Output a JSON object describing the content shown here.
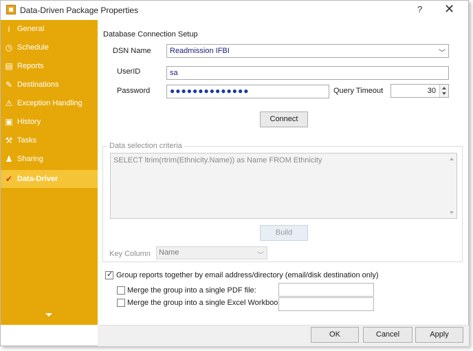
{
  "window": {
    "title": "Data-Driven Package Properties",
    "help": "?",
    "close": "✕"
  },
  "sidebar": {
    "items": [
      {
        "label": "General",
        "icon": "info-icon",
        "glyph": "i"
      },
      {
        "label": "Schedule",
        "icon": "clock-icon",
        "glyph": "◷"
      },
      {
        "label": "Reports",
        "icon": "report-icon",
        "glyph": "▤"
      },
      {
        "label": "Destinations",
        "icon": "destination-icon",
        "glyph": "✎"
      },
      {
        "label": "Exception Handling",
        "icon": "warning-icon",
        "glyph": "⚠"
      },
      {
        "label": "History",
        "icon": "history-icon",
        "glyph": "▣"
      },
      {
        "label": "Tasks",
        "icon": "tasks-icon",
        "glyph": "⚒"
      },
      {
        "label": "Sharing",
        "icon": "sharing-icon",
        "glyph": "♟"
      },
      {
        "label": "Data-Driver",
        "icon": "data-driver-icon",
        "glyph": "✔"
      }
    ],
    "active": "Data-Driver",
    "background": "#e6a808",
    "active_background": "#f6c437"
  },
  "connection": {
    "heading": "Database Connection Setup",
    "dsn_label": "DSN Name",
    "dsn_value": "Readmission IFBI",
    "userid_label": "UserID",
    "userid_value": "sa",
    "password_label": "Password",
    "password_value": "●●●●●●●●●●●●●●",
    "timeout_label": "Query Timeout",
    "timeout_value": "30",
    "connect_label": "Connect"
  },
  "criteria": {
    "title": "Data selection criteria",
    "sql": "SELECT ltrim(rtrim(Ethnicity.Name)) as Name FROM Ethnicity",
    "build_label": "Build",
    "key_column_label": "Key Column",
    "key_column_value": "Name"
  },
  "grouping": {
    "group_label": "Group reports together by email address/directory (email/disk destination only)",
    "group_checked": true,
    "merge_pdf_label": "Merge the group into a single PDF file:",
    "merge_pdf_checked": false,
    "merge_excel_label": "Merge the group into a single Excel Workbook:",
    "merge_excel_checked": false
  },
  "footer": {
    "ok": "OK",
    "cancel": "Cancel",
    "apply": "Apply"
  }
}
